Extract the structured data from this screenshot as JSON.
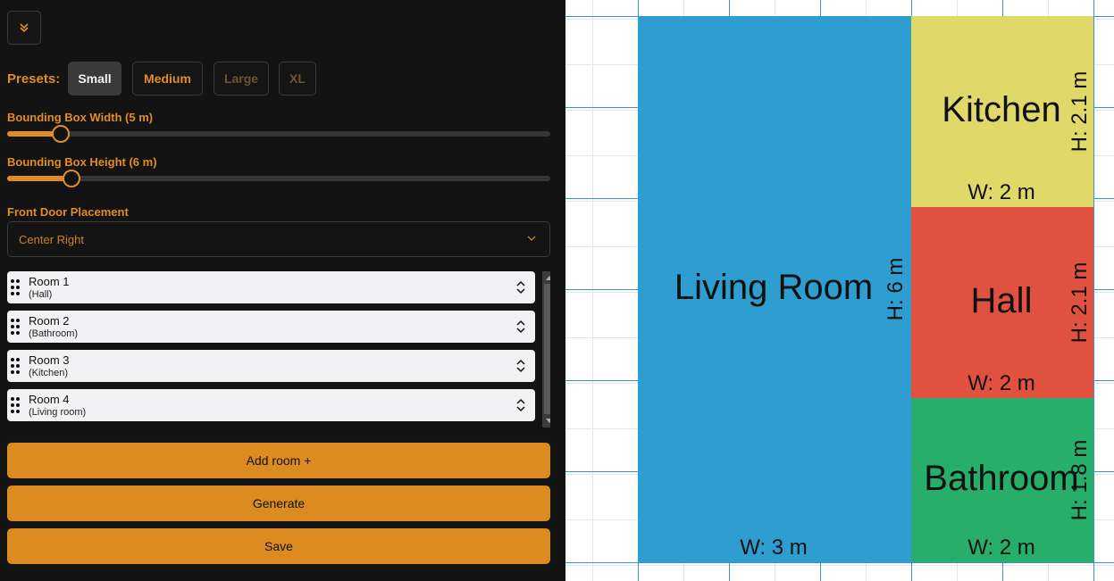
{
  "presets": {
    "label": "Presets:",
    "options": [
      "Small",
      "Medium",
      "Large",
      "XL"
    ]
  },
  "sliders": {
    "width": {
      "label": "Bounding Box Width (5 m)",
      "value_fraction": 0.095
    },
    "height": {
      "label": "Bounding Box Height (6 m)",
      "value_fraction": 0.115
    }
  },
  "door": {
    "label": "Front Door Placement",
    "value": "Center Right"
  },
  "rooms": [
    {
      "name": "Room 1",
      "type": "(Hall)"
    },
    {
      "name": "Room 2",
      "type": "(Bathroom)"
    },
    {
      "name": "Room 3",
      "type": "(Kitchen)"
    },
    {
      "name": "Room 4",
      "type": "(Living room)"
    }
  ],
  "actions": {
    "add": "Add room +",
    "generate": "Generate",
    "save": "Save"
  },
  "plan": {
    "living": {
      "name": "Living Room",
      "h": "H: 6 m",
      "w": "W: 3 m",
      "color": "#2e9dd0"
    },
    "kitchen": {
      "name": "Kitchen",
      "h": "H: 2.1 m",
      "w": "W: 2 m",
      "color": "#e0d96a"
    },
    "hall": {
      "name": "Hall",
      "h": "H: 2.1 m",
      "w": "W: 2 m",
      "color": "#e15140"
    },
    "bathroom": {
      "name": "Bathroom",
      "h": "H: 1.8 m",
      "w": "W: 2 m",
      "color": "#27ae6b"
    }
  },
  "colors": {
    "accent": "#e08d25",
    "panel": "#131313",
    "grid_major": "#3f8fd8",
    "grid_minor": "#e6e6e6"
  }
}
